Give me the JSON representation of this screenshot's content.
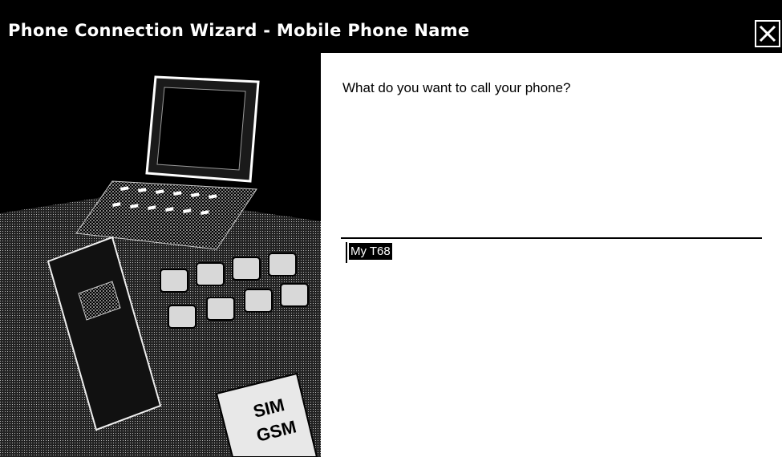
{
  "window": {
    "title": "Phone Connection Wizard - Mobile Phone Name",
    "close_icon": "close-icon"
  },
  "wizard": {
    "question": "What do you want to call your phone?",
    "name_field": {
      "value": "My T68"
    }
  },
  "illustration": {
    "badge_lines": [
      "SIM",
      "GSM"
    ]
  },
  "colors": {
    "titlebar": "#000000",
    "title_text": "#ffffff",
    "selection_bg": "#000000",
    "selection_text": "#ffffff"
  }
}
